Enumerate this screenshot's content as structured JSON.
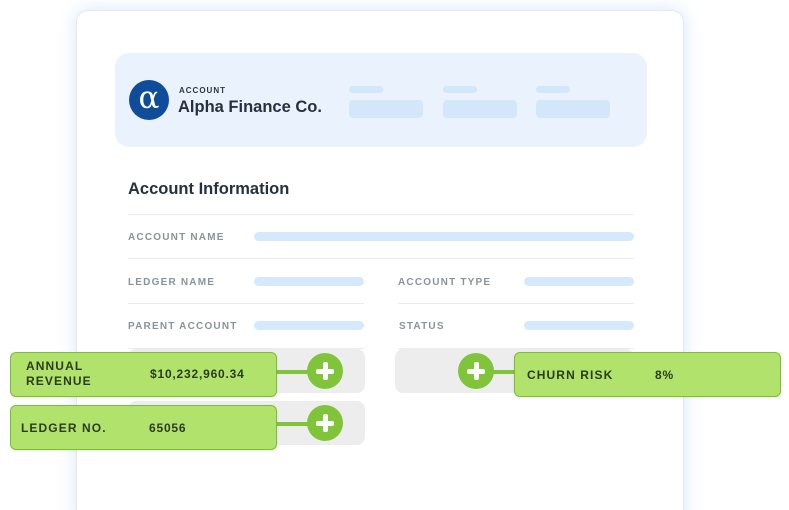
{
  "account": {
    "label": "ACCOUNT",
    "name": "Alpha Finance Co.",
    "logo_glyph": "α",
    "logo_color": "#0f4c99"
  },
  "section": {
    "title": "Account Information",
    "fields": {
      "account_name": "ACCOUNT NAME",
      "ledger_name": "LEDGER NAME",
      "account_type": "ACCOUNT TYPE",
      "parent_account": "PARENT ACCOUNT",
      "status": "STATUS"
    }
  },
  "tags": {
    "annual_revenue": {
      "label": "ANNUAL REVENUE",
      "value": "$10,232,960.34"
    },
    "ledger_no": {
      "label": "LEDGER NO.",
      "value": "65056"
    },
    "churn_risk": {
      "label": "CHURN RISK",
      "value": "8%"
    }
  },
  "colors": {
    "accent_green": "#80c43a",
    "tag_fill": "#b1e36c",
    "placeholder_blue": "#d6e9fc",
    "header_bg": "#eaf3fd"
  }
}
